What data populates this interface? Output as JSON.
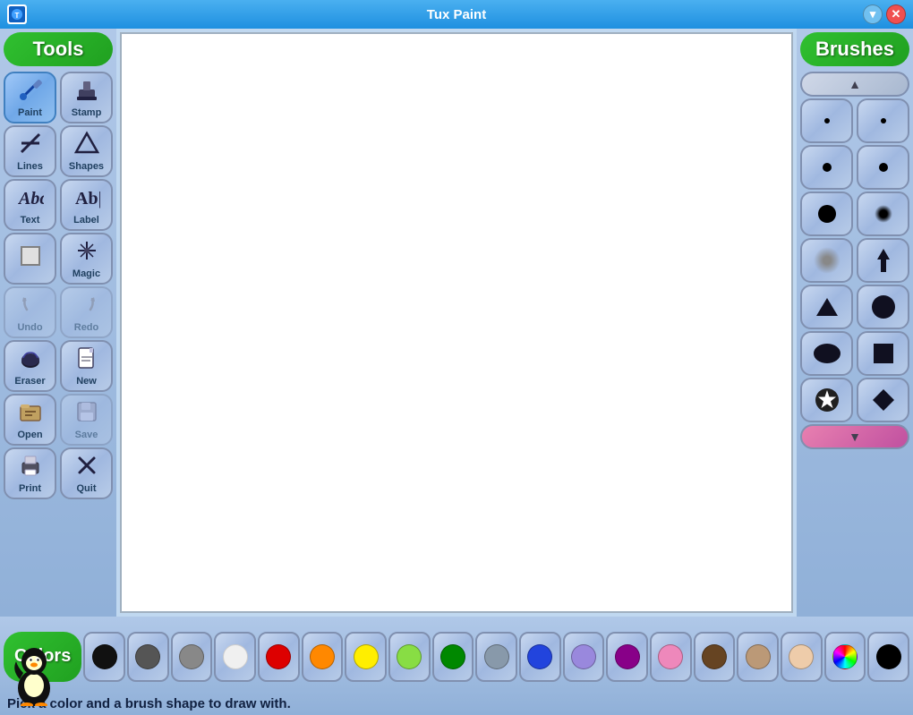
{
  "titlebar": {
    "title": "Tux Paint",
    "app_icon": "TP",
    "minimize_symbol": "▾",
    "close_symbol": "✕"
  },
  "tools_header": "Tools",
  "brushes_header": "Brushes",
  "colors_label": "Colors",
  "status_message": "Pick a color and a brush shape to draw with.",
  "tools": [
    {
      "id": "paint",
      "label": "Paint",
      "icon": "✏️",
      "active": true
    },
    {
      "id": "stamp",
      "label": "Stamp",
      "icon": "📮",
      "active": false
    },
    {
      "id": "lines",
      "label": "Lines",
      "icon": "✖",
      "active": false
    },
    {
      "id": "shapes",
      "label": "Shapes",
      "icon": "⬠",
      "active": false
    },
    {
      "id": "text",
      "label": "Text",
      "icon": "Abc",
      "active": false
    },
    {
      "id": "label",
      "label": "Label",
      "icon": "Ab|",
      "active": false
    },
    {
      "id": "fill",
      "label": "",
      "icon": "⬜",
      "active": false
    },
    {
      "id": "magic",
      "label": "Magic",
      "icon": "✦",
      "active": false
    },
    {
      "id": "undo",
      "label": "Undo",
      "icon": "↩",
      "active": false,
      "disabled": true
    },
    {
      "id": "redo",
      "label": "Redo",
      "icon": "↪",
      "active": false,
      "disabled": true
    },
    {
      "id": "eraser",
      "label": "Eraser",
      "icon": "🧹",
      "active": false
    },
    {
      "id": "new",
      "label": "New",
      "icon": "📄",
      "active": false
    },
    {
      "id": "open",
      "label": "Open",
      "icon": "📖",
      "active": false
    },
    {
      "id": "save",
      "label": "Save",
      "icon": "💾",
      "active": false,
      "disabled": true
    },
    {
      "id": "print",
      "label": "Print",
      "icon": "🖨",
      "active": false
    },
    {
      "id": "quit",
      "label": "Quit",
      "icon": "✕",
      "active": false
    }
  ],
  "colors": [
    {
      "name": "black",
      "hex": "#111111"
    },
    {
      "name": "dark-gray",
      "hex": "#555555"
    },
    {
      "name": "gray",
      "hex": "#888888"
    },
    {
      "name": "white",
      "hex": "#f0f0f0"
    },
    {
      "name": "red",
      "hex": "#dd0000"
    },
    {
      "name": "orange",
      "hex": "#ff8800"
    },
    {
      "name": "yellow",
      "hex": "#ffee00"
    },
    {
      "name": "light-green",
      "hex": "#88dd44"
    },
    {
      "name": "green",
      "hex": "#008800"
    },
    {
      "name": "blue-gray",
      "hex": "#8899aa"
    },
    {
      "name": "blue",
      "hex": "#2244dd"
    },
    {
      "name": "purple-light",
      "hex": "#9988dd"
    },
    {
      "name": "purple",
      "hex": "#880088"
    },
    {
      "name": "pink",
      "hex": "#ee88bb"
    },
    {
      "name": "brown",
      "hex": "#664422"
    },
    {
      "name": "tan",
      "hex": "#bb9977"
    },
    {
      "name": "peach",
      "hex": "#eeccaa"
    },
    {
      "name": "rainbow",
      "hex": "rainbow"
    },
    {
      "name": "black2",
      "hex": "#000000"
    }
  ]
}
